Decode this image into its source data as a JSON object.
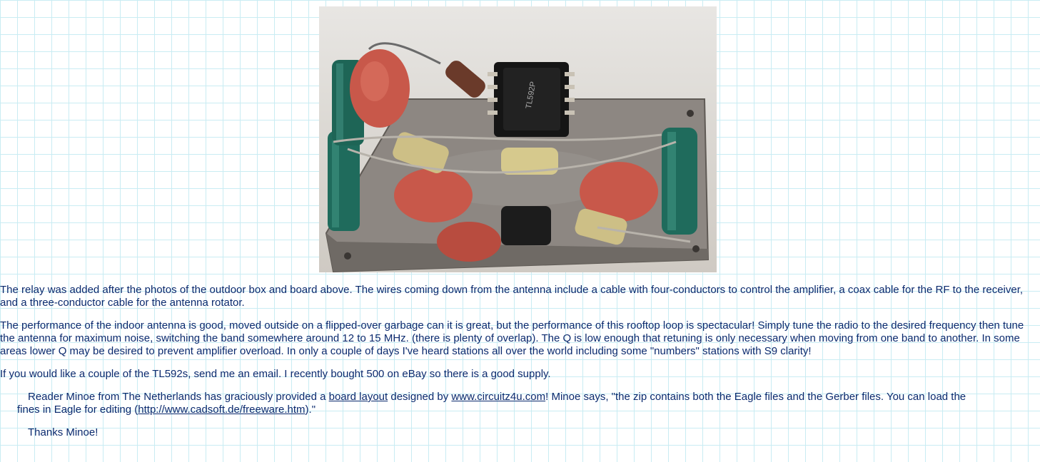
{
  "photo": {
    "alt": "Circuit board with TL592P amplifier chip, capacitors and coils",
    "chip_text": "TL592P"
  },
  "paragraphs": {
    "p1": "The relay was added after the photos of the outdoor box and board above. The wires coming down from the antenna include a cable with four-conductors to control the amplifier, a coax cable for the RF to the receiver, and a three-conductor cable for the antenna rotator.",
    "p2": "The performance of the indoor antenna is good, moved outside on a flipped-over garbage can it is great, but the performance of this rooftop loop is spectacular!  Simply tune the radio to the desired frequency then tune the antenna for maximum noise, switching the band somewhere around 12 to 15 MHz. (there is plenty of overlap). The Q is low enough that retuning is only necessary when moving from one band to another. In some areas lower Q may be desired to prevent amplifier overload. In only a couple of days I've heard stations all over the world including some \"numbers\" stations with S9 clarity!",
    "p3": "If you would like a couple of the TL592s, send me an email. I recently bought 500 on eBay so there is a good supply."
  },
  "reader_note": {
    "intro": "Reader Minoe from The Netherlands has graciously provided a ",
    "board_layout_link": "board layout",
    "mid": " designed by ",
    "circuitz_link": "www.circuitz4u.com",
    "after_link": "! Minoe says, \"the zip contains both the Eagle files and the Gerber files. You can load the fines in Eagle for editing (",
    "cadsoft_link": "http://www.cadsoft.de/freeware.htm",
    "end": ").\""
  },
  "thanks": "Thanks Minoe!",
  "colors": {
    "text": "#0b2a6e",
    "grid": "#c9ecf3",
    "background": "#ffffff"
  }
}
